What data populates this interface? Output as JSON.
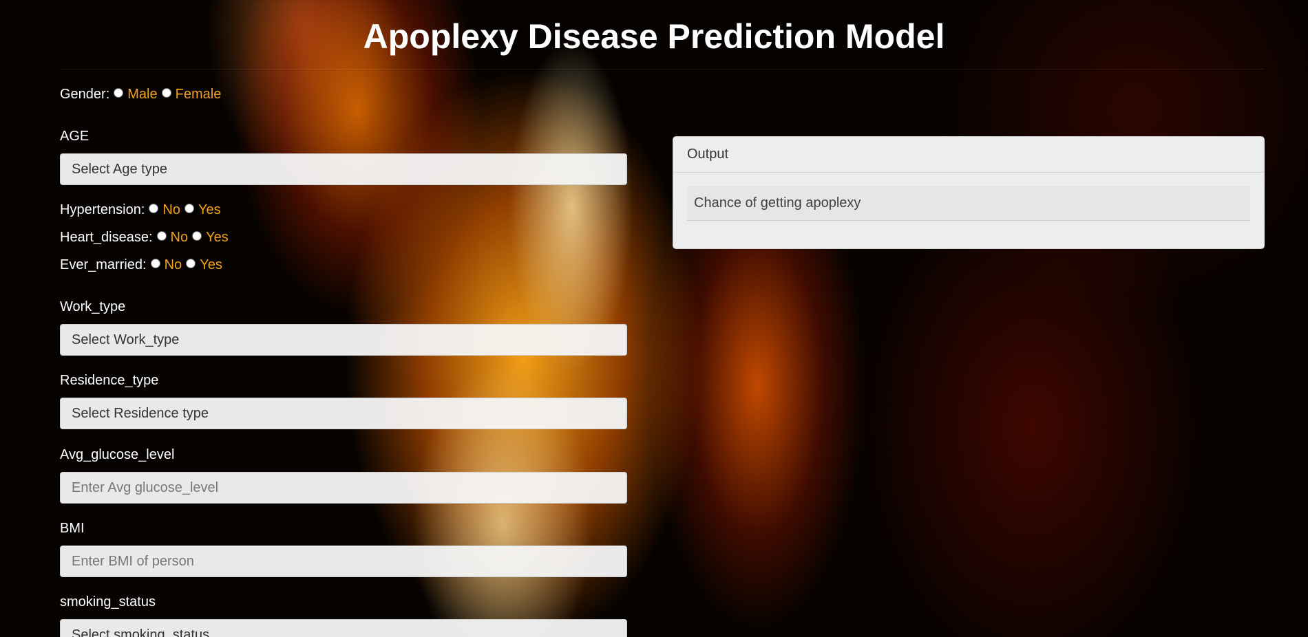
{
  "page": {
    "title": "Apoplexy Disease Prediction Model"
  },
  "form": {
    "gender": {
      "label": "Gender:",
      "options": [
        "Male",
        "Female"
      ]
    },
    "age": {
      "label": "AGE",
      "placeholder": "Select Age type"
    },
    "hypertension": {
      "label": "Hypertension:",
      "options": [
        "No",
        "Yes"
      ]
    },
    "heart_disease": {
      "label": "Heart_disease:",
      "options": [
        "No",
        "Yes"
      ]
    },
    "ever_married": {
      "label": "Ever_married:",
      "options": [
        "No",
        "Yes"
      ]
    },
    "work_type": {
      "label": "Work_type",
      "placeholder": "Select Work_type"
    },
    "residence_type": {
      "label": "Residence_type",
      "placeholder": "Select Residence type"
    },
    "avg_glucose_level": {
      "label": "Avg_glucose_level",
      "placeholder": "Enter Avg glucose_level"
    },
    "bmi": {
      "label": "BMI",
      "placeholder": "Enter BMI of person"
    },
    "smoking_status": {
      "label": "smoking_status",
      "placeholder": "Select smoking_status"
    }
  },
  "output": {
    "header": "Output",
    "result": "Chance of getting apoplexy"
  },
  "colors": {
    "accent_option": "#f3a21c",
    "label_text": "#ffffff",
    "panel_bg": "#f7f7f7"
  }
}
